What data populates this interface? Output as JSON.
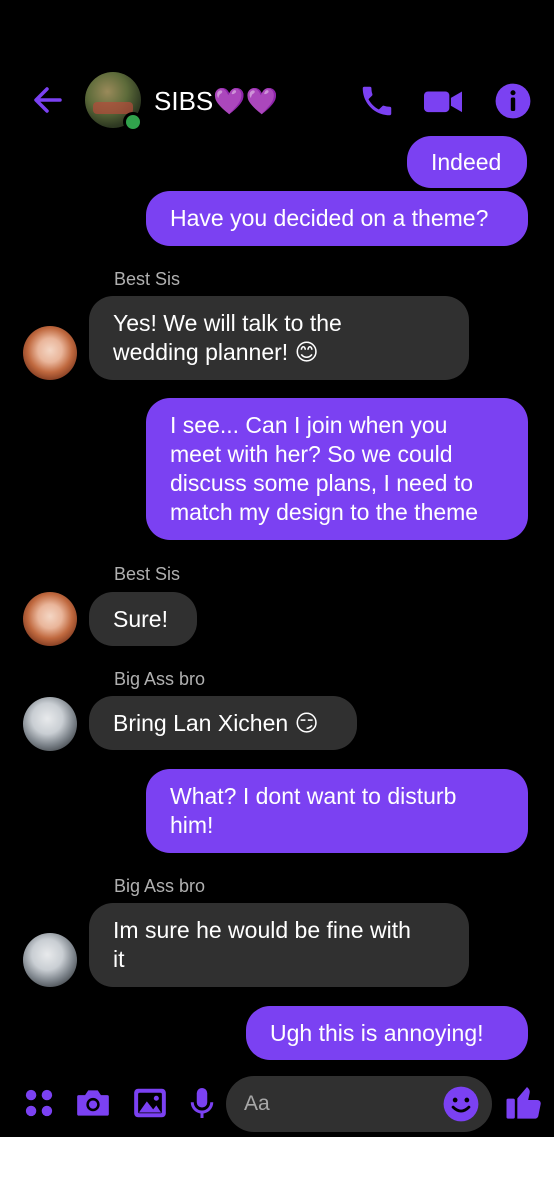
{
  "header": {
    "title": "SIBS💜💜",
    "online": true
  },
  "messages": [
    {
      "type": "outgoing",
      "lines": [
        "Indeed"
      ]
    },
    {
      "type": "outgoing",
      "lines": [
        "Have you decided on a theme?"
      ]
    },
    {
      "type": "sender",
      "name": "Best Sis"
    },
    {
      "type": "incoming",
      "lines": [
        "Yes! We will talk to the",
        "wedding planner! 😊"
      ]
    },
    {
      "type": "outgoing",
      "lines": [
        "I see... Can I join when you",
        "meet with her? So we could",
        "discuss some plans, I need to",
        "match my design to the theme"
      ]
    },
    {
      "type": "sender",
      "name": "Best Sis"
    },
    {
      "type": "incoming",
      "lines": [
        "Sure!"
      ]
    },
    {
      "type": "sender",
      "name": "Big Ass bro"
    },
    {
      "type": "incoming",
      "lines": [
        "Bring Lan Xichen 😏"
      ]
    },
    {
      "type": "outgoing",
      "lines": [
        "What? I dont want to disturb",
        "him!"
      ]
    },
    {
      "type": "sender",
      "name": "Big Ass bro"
    },
    {
      "type": "incoming",
      "lines": [
        "Im sure he would be fine with",
        "it"
      ]
    },
    {
      "type": "outgoing",
      "lines": [
        "Ugh this is annoying!"
      ]
    }
  ],
  "composer": {
    "placeholder": "Aa"
  },
  "icons": {
    "back": "arrow-left-icon",
    "phone": "phone-icon",
    "video": "video-camera-icon",
    "info": "info-icon",
    "apps": "apps-grid-icon",
    "camera": "camera-icon",
    "gallery": "image-icon",
    "mic": "microphone-icon",
    "emoji": "smiley-icon",
    "like": "thumbs-up-icon"
  },
  "colors": {
    "accent": "#7b41f2",
    "incoming_bubble": "#303030",
    "background": "#000000",
    "online": "#31a24c"
  }
}
